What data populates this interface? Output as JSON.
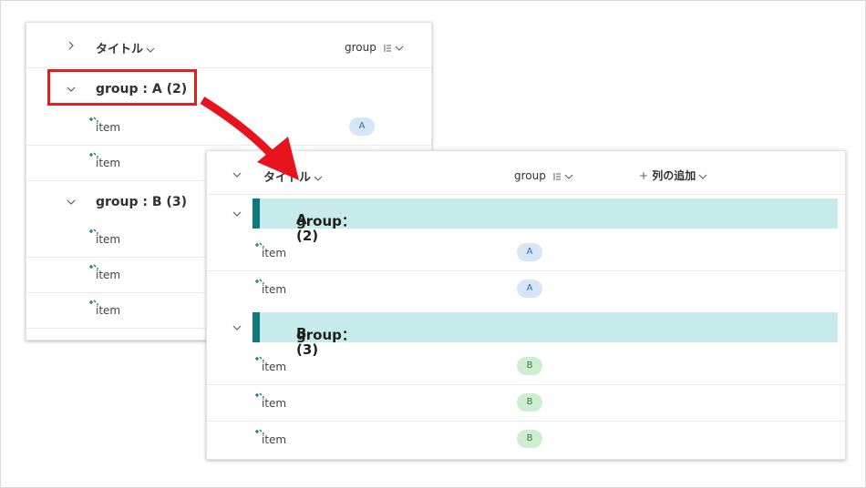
{
  "back_view": {
    "header": {
      "title_col": "タイトル",
      "group_col": "group"
    },
    "groups": [
      {
        "label": "group : A (2)",
        "items": [
          {
            "title": "item",
            "group": "A"
          },
          {
            "title": "item",
            "group": ""
          }
        ]
      },
      {
        "label": "group : B (3)",
        "items": [
          {
            "title": "item"
          },
          {
            "title": "item"
          },
          {
            "title": "item"
          }
        ]
      }
    ]
  },
  "front_view": {
    "header": {
      "title_col": "タイトル",
      "group_col": "group",
      "add_col": "列の追加"
    },
    "groups": [
      {
        "label_key": "group：",
        "label_value": "A (2)",
        "items": [
          {
            "title": "item",
            "group": "A"
          },
          {
            "title": "item",
            "group": "A"
          }
        ]
      },
      {
        "label_key": "group：",
        "label_value": "B (3)",
        "items": [
          {
            "title": "item",
            "group": "B"
          },
          {
            "title": "item",
            "group": "B"
          },
          {
            "title": "item",
            "group": "B"
          }
        ]
      }
    ]
  },
  "colors": {
    "accent_bar": "#0f7878",
    "group_band": "#c7ebea",
    "pill_a": "#d6e6f7",
    "pill_b": "#cdeed0",
    "highlight": "#e02020"
  }
}
